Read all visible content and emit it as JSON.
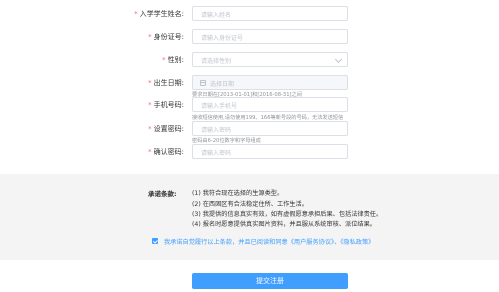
{
  "form": {
    "name": {
      "label": "入学学生姓名:",
      "placeholder": "请输入姓名"
    },
    "id_number": {
      "label": "身份证号:",
      "placeholder": "请输入身份证号"
    },
    "gender": {
      "label": "性别:",
      "placeholder": "请选择性别"
    },
    "birth_date": {
      "label": "出生日期:",
      "placeholder": "选择日期",
      "hint": "要求日期在[2013-01-01]和[2016-08-31]之间"
    },
    "phone": {
      "label": "手机号码:",
      "placeholder": "请输入手机号",
      "hint": "接收短信使用,请勿使用199、166等新号段的号码，无法发送短信"
    },
    "password": {
      "label": "设置密码:",
      "placeholder": "请输入密码",
      "hint": "密码由6-20位数字和字母组成"
    },
    "confirm_password": {
      "label": "确认密码:",
      "placeholder": "请输入密码"
    }
  },
  "terms": {
    "title": "承诺条款:",
    "items": [
      "(1) 我符合现在选择的生源类型。",
      "(2) 在西固区有合法稳定住所、工作生活。",
      "(3) 我提供的信息真实有效，如有虚假愿意承担后果、包括法律责任。",
      "(4) 报名时愿意提供真实图片资料，并且服从系统审核、派位结果。"
    ],
    "agree_text": "我承诺自觉履行以上条款，并且已阅读和同意《用户服务协议》、《隐私政策》",
    "agree_checked": true
  },
  "submit_label": "提交注册",
  "colors": {
    "primary": "#409eff",
    "required": "#f56c6c"
  },
  "icons": {
    "gender": "chevron-down-icon",
    "birth_date": "calendar-icon",
    "agree": "checkbox-checked-icon"
  }
}
